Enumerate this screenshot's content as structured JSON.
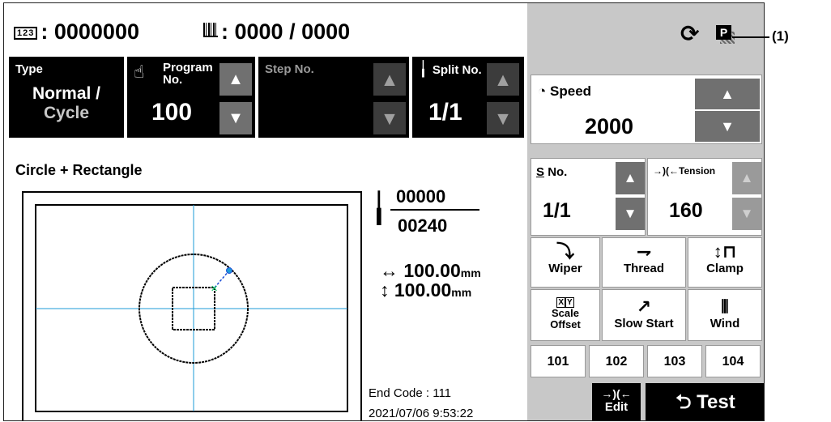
{
  "header": {
    "counter_icon": "123-counter-icon",
    "counter_value": "0000000",
    "bobbin_icon": "bobbin-counter-icon",
    "bobbin_value": "0000 / 0000",
    "sync_icon": "repeat-icon",
    "p_icon": "P"
  },
  "program": {
    "type_label": "Type",
    "type_value1": "Normal /",
    "type_value2": "Cycle",
    "program_label1": "Program",
    "program_label2": "No.",
    "program_value": "100",
    "step_label": "Step No.",
    "split_label": "Split No.",
    "split_value": "1/1",
    "up": "▲",
    "down": "▼"
  },
  "pattern": {
    "title": "Circle + Rectangle",
    "stitch_current": "00000",
    "stitch_total": "00240",
    "x_size": "100.00",
    "y_size": "100.00",
    "unit": "mm",
    "x_arrow": "↔",
    "y_arrow": "↕",
    "end_code": "End Code : 111",
    "datetime": "2021/07/06  9:53:22"
  },
  "speed": {
    "label": "Speed",
    "value": "2000"
  },
  "sno": {
    "label": "No.",
    "value": "1/1"
  },
  "tension": {
    "label": "Tension",
    "value": "160"
  },
  "functions": {
    "wiper": "Wiper",
    "thread": "Thread",
    "clamp": "Clamp",
    "scale_offset1": "Scale",
    "scale_offset2": "Offset",
    "xy_x": "X",
    "xy_y": "Y",
    "slow_start": "Slow Start",
    "wind": "Wind"
  },
  "numbers": [
    "101",
    "102",
    "103",
    "104"
  ],
  "buttons": {
    "edit_icon": "→)(←",
    "edit": "Edit",
    "test": "Test"
  },
  "annotation": "(1)",
  "colors": {
    "panel_gray": "#c8c8c8",
    "arrow_gray": "#707070",
    "crosshair": "#1e9bd7",
    "start_marker": "#00c060",
    "end_marker": "#1e4fd7"
  }
}
